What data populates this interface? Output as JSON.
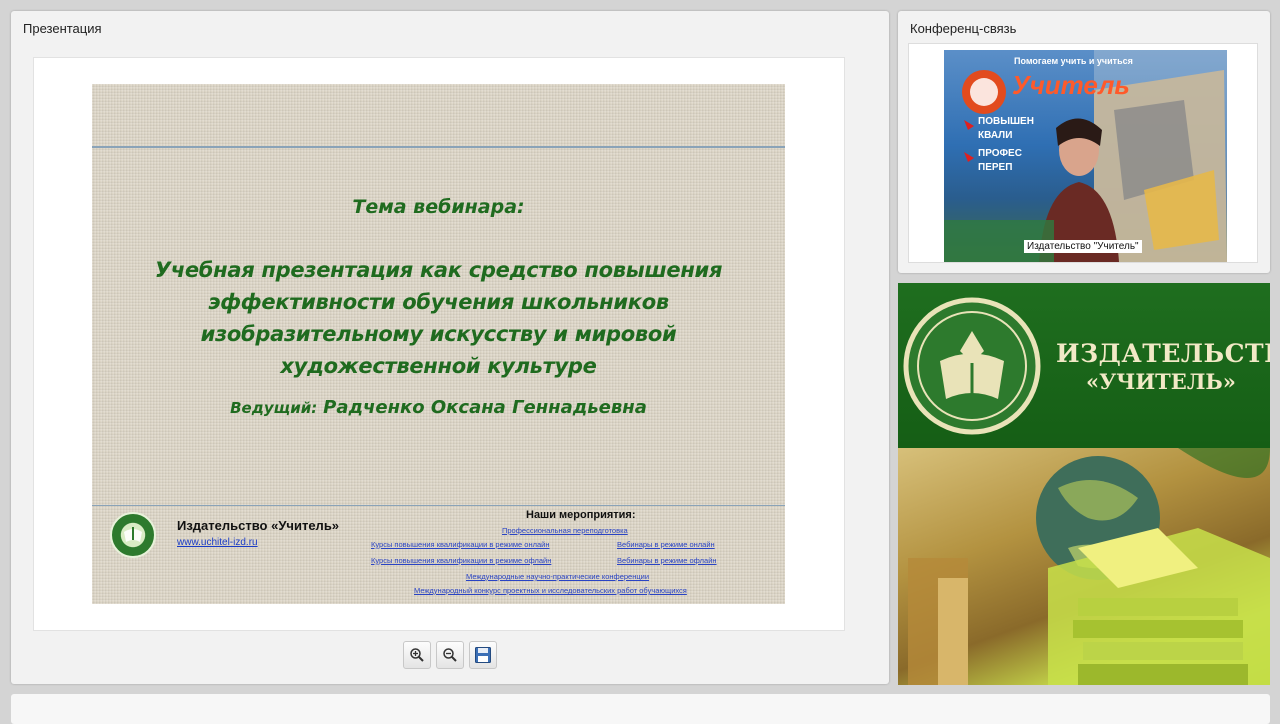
{
  "presentation": {
    "title": "Презентация",
    "slide": {
      "theme_label": "Тема вебинара:",
      "theme_text": "Учебная презентация как средство повышения эффективности обучения школьников изобразительному искусству и мировой художественной культуре",
      "host_label": "Ведущий:",
      "host_name": "Радченко Оксана Геннадьевна",
      "publisher": "Издательство «Учитель»",
      "url": "www.uchitel-izd.ru",
      "events_title": "Наши мероприятия:",
      "events": [
        "Профессиональная переподготовка",
        "Курсы повышения квалификации в режиме онлайн",
        "Вебинары в режиме онлайн",
        "Курсы повышения квалификации в режиме офлайн",
        "Вебинары в режиме офлайн",
        "Международные научно-практические конференции",
        "Международный конкурс проектных и исследовательских работ обучающихся"
      ]
    },
    "toolbar": {
      "zoom_in_icon": "zoom-in-icon",
      "zoom_out_icon": "zoom-out-icon",
      "save_icon": "save-icon"
    }
  },
  "conference": {
    "title": "Конференц-связь",
    "video": {
      "participant_name": "Издательство \"Учитель\"",
      "poster_text": "Помогаем учить и учиться",
      "poster_brand": "Учитель",
      "poster_lines": [
        "ПОВЫШЕН",
        "КВАЛИ",
        "ПРОФЕС",
        "ПЕРЕП"
      ]
    }
  },
  "banner": {
    "name_line1": "ИЗДАТЕЛЬСТВО",
    "name_line2": "«УЧИТЕЛЬ»"
  }
}
